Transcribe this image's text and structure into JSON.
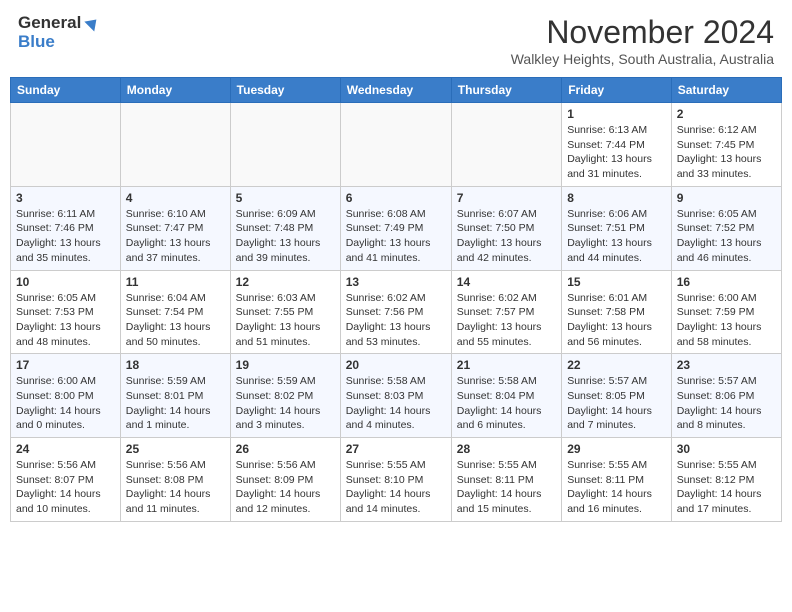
{
  "header": {
    "logo_line1": "General",
    "logo_line2": "Blue",
    "title": "November 2024",
    "subtitle": "Walkley Heights, South Australia, Australia"
  },
  "calendar": {
    "headers": [
      "Sunday",
      "Monday",
      "Tuesday",
      "Wednesday",
      "Thursday",
      "Friday",
      "Saturday"
    ],
    "rows": [
      [
        {
          "day": "",
          "info": ""
        },
        {
          "day": "",
          "info": ""
        },
        {
          "day": "",
          "info": ""
        },
        {
          "day": "",
          "info": ""
        },
        {
          "day": "",
          "info": ""
        },
        {
          "day": "1",
          "info": "Sunrise: 6:13 AM\nSunset: 7:44 PM\nDaylight: 13 hours\nand 31 minutes."
        },
        {
          "day": "2",
          "info": "Sunrise: 6:12 AM\nSunset: 7:45 PM\nDaylight: 13 hours\nand 33 minutes."
        }
      ],
      [
        {
          "day": "3",
          "info": "Sunrise: 6:11 AM\nSunset: 7:46 PM\nDaylight: 13 hours\nand 35 minutes."
        },
        {
          "day": "4",
          "info": "Sunrise: 6:10 AM\nSunset: 7:47 PM\nDaylight: 13 hours\nand 37 minutes."
        },
        {
          "day": "5",
          "info": "Sunrise: 6:09 AM\nSunset: 7:48 PM\nDaylight: 13 hours\nand 39 minutes."
        },
        {
          "day": "6",
          "info": "Sunrise: 6:08 AM\nSunset: 7:49 PM\nDaylight: 13 hours\nand 41 minutes."
        },
        {
          "day": "7",
          "info": "Sunrise: 6:07 AM\nSunset: 7:50 PM\nDaylight: 13 hours\nand 42 minutes."
        },
        {
          "day": "8",
          "info": "Sunrise: 6:06 AM\nSunset: 7:51 PM\nDaylight: 13 hours\nand 44 minutes."
        },
        {
          "day": "9",
          "info": "Sunrise: 6:05 AM\nSunset: 7:52 PM\nDaylight: 13 hours\nand 46 minutes."
        }
      ],
      [
        {
          "day": "10",
          "info": "Sunrise: 6:05 AM\nSunset: 7:53 PM\nDaylight: 13 hours\nand 48 minutes."
        },
        {
          "day": "11",
          "info": "Sunrise: 6:04 AM\nSunset: 7:54 PM\nDaylight: 13 hours\nand 50 minutes."
        },
        {
          "day": "12",
          "info": "Sunrise: 6:03 AM\nSunset: 7:55 PM\nDaylight: 13 hours\nand 51 minutes."
        },
        {
          "day": "13",
          "info": "Sunrise: 6:02 AM\nSunset: 7:56 PM\nDaylight: 13 hours\nand 53 minutes."
        },
        {
          "day": "14",
          "info": "Sunrise: 6:02 AM\nSunset: 7:57 PM\nDaylight: 13 hours\nand 55 minutes."
        },
        {
          "day": "15",
          "info": "Sunrise: 6:01 AM\nSunset: 7:58 PM\nDaylight: 13 hours\nand 56 minutes."
        },
        {
          "day": "16",
          "info": "Sunrise: 6:00 AM\nSunset: 7:59 PM\nDaylight: 13 hours\nand 58 minutes."
        }
      ],
      [
        {
          "day": "17",
          "info": "Sunrise: 6:00 AM\nSunset: 8:00 PM\nDaylight: 14 hours\nand 0 minutes."
        },
        {
          "day": "18",
          "info": "Sunrise: 5:59 AM\nSunset: 8:01 PM\nDaylight: 14 hours\nand 1 minute."
        },
        {
          "day": "19",
          "info": "Sunrise: 5:59 AM\nSunset: 8:02 PM\nDaylight: 14 hours\nand 3 minutes."
        },
        {
          "day": "20",
          "info": "Sunrise: 5:58 AM\nSunset: 8:03 PM\nDaylight: 14 hours\nand 4 minutes."
        },
        {
          "day": "21",
          "info": "Sunrise: 5:58 AM\nSunset: 8:04 PM\nDaylight: 14 hours\nand 6 minutes."
        },
        {
          "day": "22",
          "info": "Sunrise: 5:57 AM\nSunset: 8:05 PM\nDaylight: 14 hours\nand 7 minutes."
        },
        {
          "day": "23",
          "info": "Sunrise: 5:57 AM\nSunset: 8:06 PM\nDaylight: 14 hours\nand 8 minutes."
        }
      ],
      [
        {
          "day": "24",
          "info": "Sunrise: 5:56 AM\nSunset: 8:07 PM\nDaylight: 14 hours\nand 10 minutes."
        },
        {
          "day": "25",
          "info": "Sunrise: 5:56 AM\nSunset: 8:08 PM\nDaylight: 14 hours\nand 11 minutes."
        },
        {
          "day": "26",
          "info": "Sunrise: 5:56 AM\nSunset: 8:09 PM\nDaylight: 14 hours\nand 12 minutes."
        },
        {
          "day": "27",
          "info": "Sunrise: 5:55 AM\nSunset: 8:10 PM\nDaylight: 14 hours\nand 14 minutes."
        },
        {
          "day": "28",
          "info": "Sunrise: 5:55 AM\nSunset: 8:11 PM\nDaylight: 14 hours\nand 15 minutes."
        },
        {
          "day": "29",
          "info": "Sunrise: 5:55 AM\nSunset: 8:11 PM\nDaylight: 14 hours\nand 16 minutes."
        },
        {
          "day": "30",
          "info": "Sunrise: 5:55 AM\nSunset: 8:12 PM\nDaylight: 14 hours\nand 17 minutes."
        }
      ]
    ]
  }
}
